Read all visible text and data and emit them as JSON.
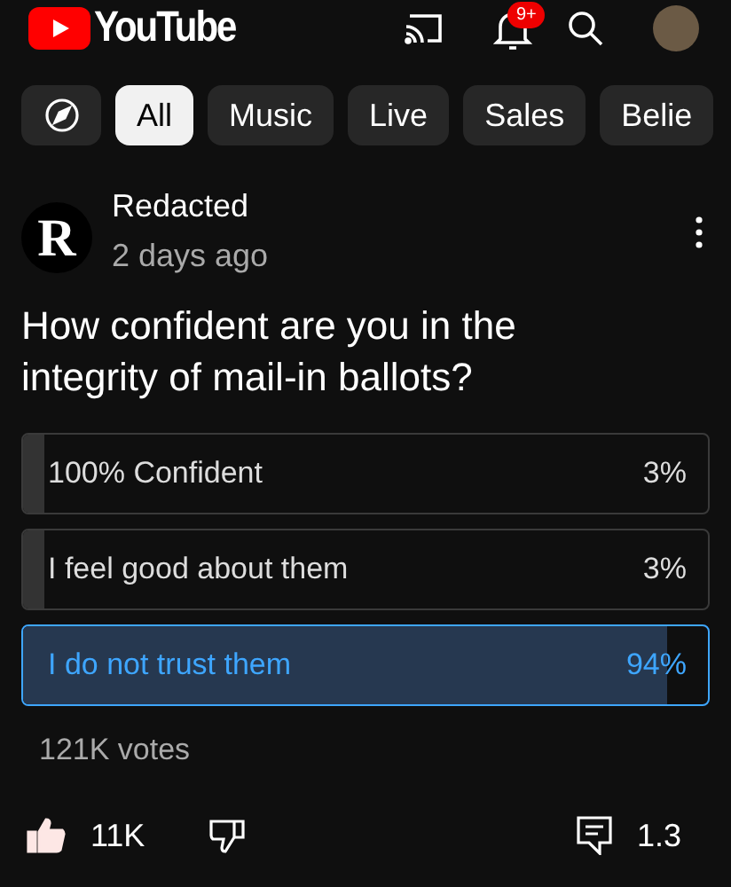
{
  "header": {
    "logo_text": "YouTube",
    "notification_badge": "9+"
  },
  "chips": [
    {
      "label": "All",
      "selected": true
    },
    {
      "label": "Music",
      "selected": false
    },
    {
      "label": "Live",
      "selected": false
    },
    {
      "label": "Sales",
      "selected": false
    },
    {
      "label": "Belie",
      "selected": false
    }
  ],
  "post": {
    "avatar_letter": "R",
    "author": "Redacted",
    "time": "2 days ago",
    "question": "How confident are you in the integrity of mail-in ballots?",
    "options": [
      {
        "label": "100% Confident",
        "percent": "3%",
        "level": 0.03,
        "selected": false
      },
      {
        "label": "I feel good about them",
        "percent": "3%",
        "level": 0.03,
        "selected": false
      },
      {
        "label": "I do not trust them",
        "percent": "94%",
        "level": 0.94,
        "selected": true
      }
    ],
    "votes": "121K votes",
    "likes": "11K",
    "liked": true,
    "comments": "1.3"
  }
}
